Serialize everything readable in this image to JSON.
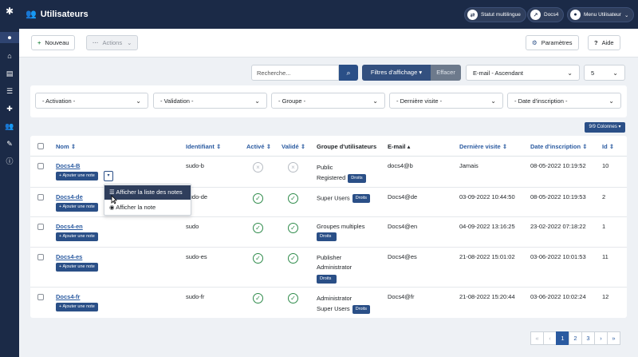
{
  "app": {
    "title": "Utilisateurs",
    "multilingual_label": "Statut multilingue",
    "site_label": "Docs4",
    "user_menu_label": "Menu Utilisateur"
  },
  "toolbar": {
    "new_label": "Nouveau",
    "actions_label": "Actions",
    "params_label": "Paramètres",
    "help_label": "Aide"
  },
  "search": {
    "placeholder": "Recherche...",
    "filters_label": "Filtres d'affichage",
    "clear_label": "Effacer",
    "sort_value": "E-mail - Ascendant",
    "limit_value": "5"
  },
  "filters": {
    "activation": "- Activation -",
    "validation": "- Validation -",
    "group": "- Groupe -",
    "last_visit": "- Dernière visite -",
    "register_date": "- Date d'inscription -"
  },
  "columns_button": "9/9 Colonnes",
  "table": {
    "headers": {
      "name": "Nom",
      "username": "Identifiant",
      "active": "Activé",
      "validated": "Validé",
      "groups": "Groupe d'utilisateurs",
      "email": "E-mail",
      "last_visit": "Dernière visite",
      "register_date": "Date d'inscription",
      "id": "Id"
    },
    "note_label": "Ajouter une note",
    "rights_label": "Droits",
    "rows": [
      {
        "name": "Docs4-B",
        "username": "sudo-b",
        "active": false,
        "validated": false,
        "group1": "Public",
        "group2": "Registered",
        "email": "docs4@b",
        "last_visit": "Jamais",
        "register_date": "08-05-2022 10:19:52",
        "id": "10"
      },
      {
        "name": "Docs4-de",
        "username": "sudo-de",
        "active": true,
        "validated": true,
        "group1": "Super Users",
        "group2": "",
        "email": "Docs4@de",
        "last_visit": "03-09-2022 10:44:50",
        "register_date": "08-05-2022 10:19:53",
        "id": "2"
      },
      {
        "name": "Docs4-en",
        "username": "sudo",
        "active": true,
        "validated": true,
        "group1": "Groupes multiples",
        "group2": "",
        "email": "Docs4@en",
        "last_visit": "04-09-2022 13:16:25",
        "register_date": "23-02-2022 07:18:22",
        "id": "1"
      },
      {
        "name": "Docs4-es",
        "username": "sudo-es",
        "active": true,
        "validated": true,
        "group1": "Publisher",
        "group2": "Administrator",
        "email": "Docs4@es",
        "last_visit": "21-08-2022 15:01:02",
        "register_date": "03-06-2022 10:01:53",
        "id": "11"
      },
      {
        "name": "Docs4-fr",
        "username": "sudo-fr",
        "active": true,
        "validated": true,
        "group1": "Administrator",
        "group2": "Super Users",
        "email": "Docs4@fr",
        "last_visit": "21-08-2022 15:20:44",
        "register_date": "03-06-2022 10:02:24",
        "id": "12"
      }
    ]
  },
  "dropdown": {
    "item1": "Afficher la liste des notes",
    "item2": "Afficher la note"
  },
  "pagination": {
    "first": "«",
    "prev": "‹",
    "pages": [
      "1",
      "2",
      "3"
    ],
    "next": "›",
    "last": "»",
    "current": "1"
  },
  "icons": {
    "sidebar": [
      "toggle-icon",
      "home-icon",
      "file-icon",
      "list-icon",
      "puzzle-icon",
      "users-icon",
      "wrench-icon",
      "info-icon"
    ]
  },
  "colors": {
    "sidebar": "#1b2a47",
    "primary": "#2a4f87",
    "link": "#2a5aa0",
    "success": "#2e8b4a"
  }
}
